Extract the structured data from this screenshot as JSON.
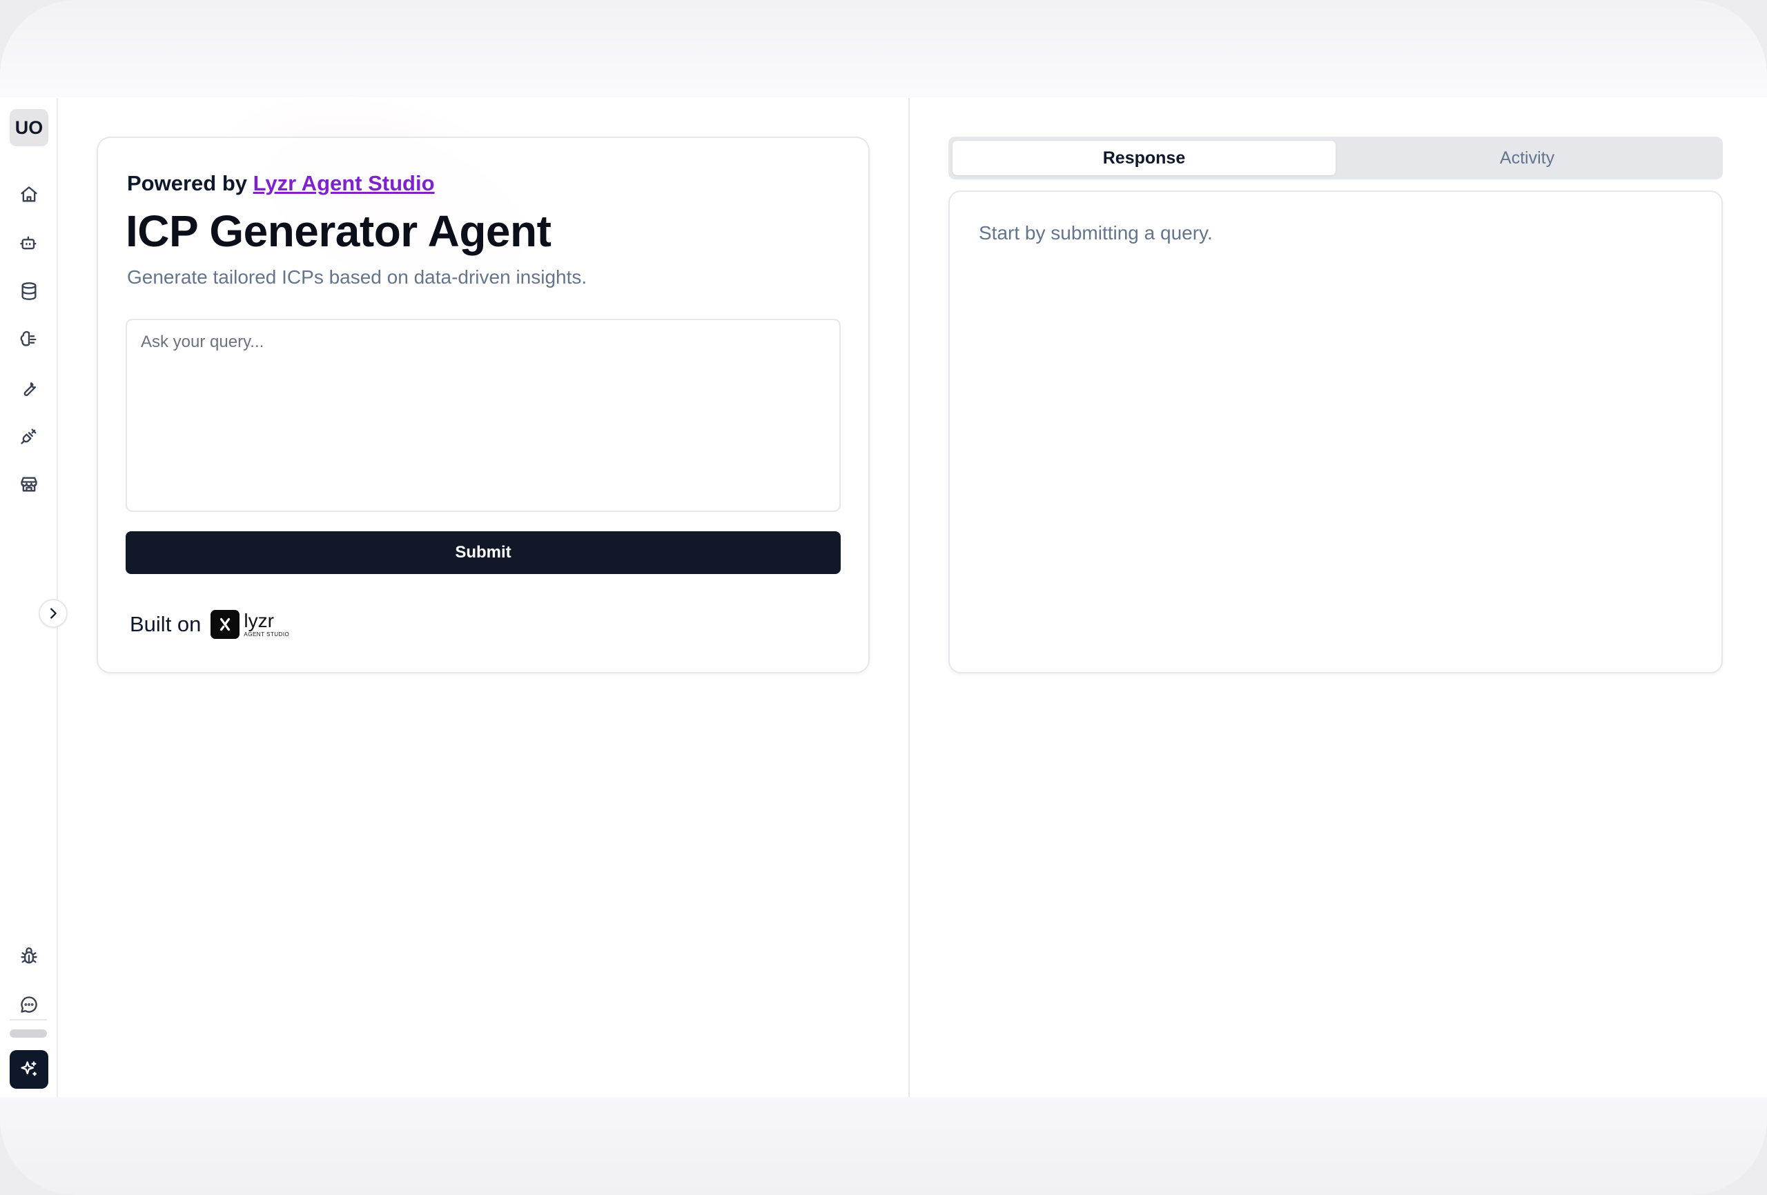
{
  "sidebar": {
    "avatar": "UO",
    "nav": [
      "home-icon",
      "agent-bot-icon",
      "database-icon",
      "brain-icon",
      "wrench-icon",
      "plug-icon",
      "store-icon"
    ],
    "bottom": [
      "bug-icon",
      "chat-bubble-icon",
      "sparkles-icon"
    ]
  },
  "agent": {
    "powered_prefix": "Powered by",
    "powered_link": "Lyzr Agent Studio",
    "title": "ICP Generator Agent",
    "subtitle": "Generate tailored ICPs based on data-driven insights.",
    "query_placeholder": "Ask your query...",
    "submit_label": "Submit",
    "built_on": "Built on",
    "logo_word": "lyzr",
    "logo_sub": "AGENT STUDIO"
  },
  "output": {
    "tabs": [
      "Response",
      "Activity"
    ],
    "active_tab": "Response",
    "empty_text": "Start by submitting a query."
  },
  "colors": {
    "accent_link": "#7e22ce",
    "primary_button": "#111827",
    "muted_text": "#64748b"
  }
}
